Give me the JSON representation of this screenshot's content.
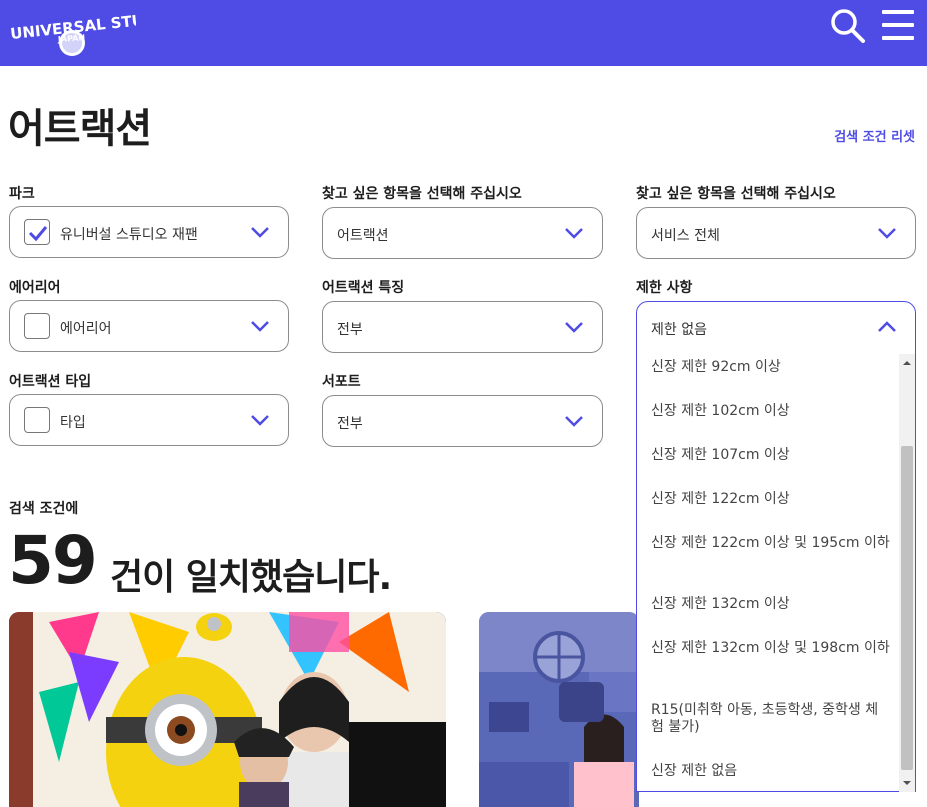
{
  "header": {
    "logo_text_top": "UNIVERSAL STUDIOS",
    "logo_text_bottom": "JAPAN",
    "search_icon": "search-icon",
    "menu_icon": "menu-icon",
    "brand_color": "#4f4ce5"
  },
  "page": {
    "title": "어트랙션",
    "reset_label": "검색 조건 리셋"
  },
  "filters": {
    "park": {
      "label": "파크",
      "value": "유니버설 스튜디오 재팬",
      "checked": true
    },
    "category": {
      "label": "찾고 싶은 항목을 선택해 주십시오",
      "value": "어트랙션"
    },
    "service": {
      "label": "찾고 싶은 항목을 선택해 주십시오",
      "value": "서비스 전체"
    },
    "area": {
      "label": "에어리어",
      "value": "에어리어",
      "checked": false
    },
    "feature": {
      "label": "어트랙션 특징",
      "value": "전부"
    },
    "restriction": {
      "label": "제한 사항",
      "value": "제한 없음",
      "open": true
    },
    "type": {
      "label": "어트랙션 타입",
      "value": "타입",
      "checked": false
    },
    "support": {
      "label": "서포트",
      "value": "전부"
    }
  },
  "restriction_options": [
    "신장 제한 92cm 이상",
    "신장 제한 102cm 이상",
    "신장 제한 107cm 이상",
    "신장 제한 122cm 이상",
    "신장 제한 122cm 이상 및 195cm 이하",
    "신장 제한 132cm 이상",
    "신장 제한 132cm 이상 및 198cm 이하",
    "R15(미취학 아동, 초등학생, 중학생 체험 불가)",
    "신장 제한 없음"
  ],
  "results": {
    "label": "검색 조건에",
    "count": "59",
    "suffix": "건이 일치했습니다."
  },
  "cards": [
    {
      "image": "minion-attraction-photo"
    },
    {
      "image": "play-area-photo"
    }
  ]
}
